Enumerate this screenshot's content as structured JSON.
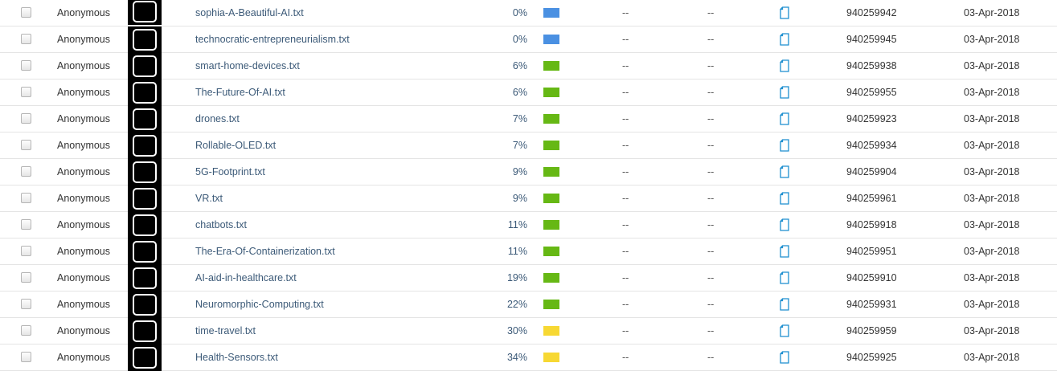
{
  "colors": {
    "blue_bar": "#4a90e2",
    "green_bar": "#66b814",
    "yellow_bar": "#f7d833",
    "link": "#3c5a78",
    "icon": "#1c8ecf"
  },
  "rows": [
    {
      "author": "Anonymous",
      "title": "sophia-A-Beautiful-AI.txt",
      "similarity": "0%",
      "similarity_value": 0,
      "bar_color": "blue",
      "col_a": "--",
      "col_b": "--",
      "icon": "file-icon",
      "paper_id": "940259942",
      "date": "03-Apr-2018"
    },
    {
      "author": "Anonymous",
      "title": "technocratic-entrepreneurialism.txt",
      "similarity": "0%",
      "similarity_value": 0,
      "bar_color": "blue",
      "col_a": "--",
      "col_b": "--",
      "icon": "file-icon",
      "paper_id": "940259945",
      "date": "03-Apr-2018"
    },
    {
      "author": "Anonymous",
      "title": "smart-home-devices.txt",
      "similarity": "6%",
      "similarity_value": 6,
      "bar_color": "green",
      "col_a": "--",
      "col_b": "--",
      "icon": "file-icon",
      "paper_id": "940259938",
      "date": "03-Apr-2018"
    },
    {
      "author": "Anonymous",
      "title": "The-Future-Of-AI.txt",
      "similarity": "6%",
      "similarity_value": 6,
      "bar_color": "green",
      "col_a": "--",
      "col_b": "--",
      "icon": "file-icon",
      "paper_id": "940259955",
      "date": "03-Apr-2018"
    },
    {
      "author": "Anonymous",
      "title": "drones.txt",
      "similarity": "7%",
      "similarity_value": 7,
      "bar_color": "green",
      "col_a": "--",
      "col_b": "--",
      "icon": "file-icon",
      "paper_id": "940259923",
      "date": "03-Apr-2018"
    },
    {
      "author": "Anonymous",
      "title": "Rollable-OLED.txt",
      "similarity": "7%",
      "similarity_value": 7,
      "bar_color": "green",
      "col_a": "--",
      "col_b": "--",
      "icon": "file-icon",
      "paper_id": "940259934",
      "date": "03-Apr-2018"
    },
    {
      "author": "Anonymous",
      "title": "5G-Footprint.txt",
      "similarity": "9%",
      "similarity_value": 9,
      "bar_color": "green",
      "col_a": "--",
      "col_b": "--",
      "icon": "file-icon",
      "paper_id": "940259904",
      "date": "03-Apr-2018"
    },
    {
      "author": "Anonymous",
      "title": "VR.txt",
      "similarity": "9%",
      "similarity_value": 9,
      "bar_color": "green",
      "col_a": "--",
      "col_b": "--",
      "icon": "file-icon",
      "paper_id": "940259961",
      "date": "03-Apr-2018"
    },
    {
      "author": "Anonymous",
      "title": "chatbots.txt",
      "similarity": "11%",
      "similarity_value": 11,
      "bar_color": "green",
      "col_a": "--",
      "col_b": "--",
      "icon": "file-icon",
      "paper_id": "940259918",
      "date": "03-Apr-2018"
    },
    {
      "author": "Anonymous",
      "title": "The-Era-Of-Containerization.txt",
      "similarity": "11%",
      "similarity_value": 11,
      "bar_color": "green",
      "col_a": "--",
      "col_b": "--",
      "icon": "file-icon",
      "paper_id": "940259951",
      "date": "03-Apr-2018"
    },
    {
      "author": "Anonymous",
      "title": "AI-aid-in-healthcare.txt",
      "similarity": "19%",
      "similarity_value": 19,
      "bar_color": "green",
      "col_a": "--",
      "col_b": "--",
      "icon": "file-icon",
      "paper_id": "940259910",
      "date": "03-Apr-2018"
    },
    {
      "author": "Anonymous",
      "title": "Neuromorphic-Computing.txt",
      "similarity": "22%",
      "similarity_value": 22,
      "bar_color": "green",
      "col_a": "--",
      "col_b": "--",
      "icon": "file-icon",
      "paper_id": "940259931",
      "date": "03-Apr-2018"
    },
    {
      "author": "Anonymous",
      "title": "time-travel.txt",
      "similarity": "30%",
      "similarity_value": 30,
      "bar_color": "yellow",
      "col_a": "--",
      "col_b": "--",
      "icon": "file-icon",
      "paper_id": "940259959",
      "date": "03-Apr-2018"
    },
    {
      "author": "Anonymous",
      "title": "Health-Sensors.txt",
      "similarity": "34%",
      "similarity_value": 34,
      "bar_color": "yellow",
      "col_a": "--",
      "col_b": "--",
      "icon": "file-icon",
      "paper_id": "940259925",
      "date": "03-Apr-2018"
    }
  ]
}
